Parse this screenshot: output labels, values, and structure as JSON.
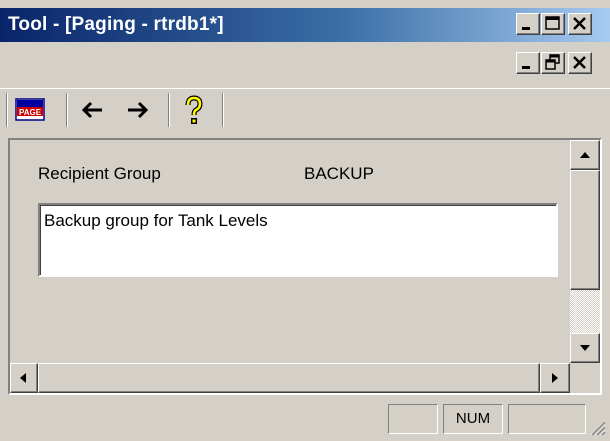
{
  "window": {
    "title": "Tool - [Paging - rtrdb1*]"
  },
  "titlebar_buttons": [
    "minimize",
    "maximize",
    "close"
  ],
  "mdi_buttons": [
    "minimize",
    "restore",
    "close"
  ],
  "toolbar": {
    "items": [
      {
        "icon": "page-icon",
        "label": "PAGE"
      },
      {
        "icon": "arrow-left-icon"
      },
      {
        "icon": "arrow-right-icon"
      },
      {
        "icon": "help-icon"
      }
    ]
  },
  "form": {
    "recipient_group_label": "Recipient Group",
    "recipient_group_value": "BACKUP",
    "description": "Backup group for Tank Levels"
  },
  "statusbar": {
    "panels": [
      "",
      "NUM",
      ""
    ]
  },
  "colors": {
    "titlebar_start": "#0a246a",
    "titlebar_end": "#a6caf0",
    "face": "#d4d0c8"
  }
}
